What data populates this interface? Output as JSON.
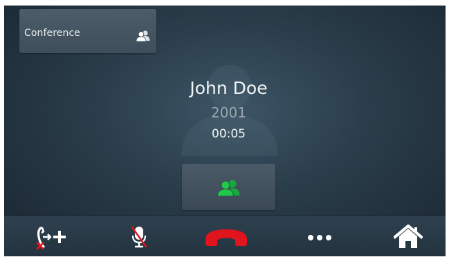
{
  "conference_tile": {
    "label": "Conference",
    "icon": "people-group-icon"
  },
  "caller": {
    "name": "John Doe",
    "number": "2001",
    "duration": "00:05"
  },
  "center_action": {
    "icon": "people-group-icon",
    "color": "#1fc94a"
  },
  "toolbar": {
    "buttons": [
      {
        "icon": "transfer-icon"
      },
      {
        "icon": "microphone-muted-icon"
      },
      {
        "icon": "hang-up-icon",
        "color": "#e0141c"
      },
      {
        "icon": "more-options-icon"
      },
      {
        "icon": "home-icon"
      }
    ]
  },
  "colors": {
    "background": "#2b3e4b",
    "accent_green": "#1fc94a",
    "hangup_red": "#e0141c",
    "mute_red": "#e0141c"
  }
}
